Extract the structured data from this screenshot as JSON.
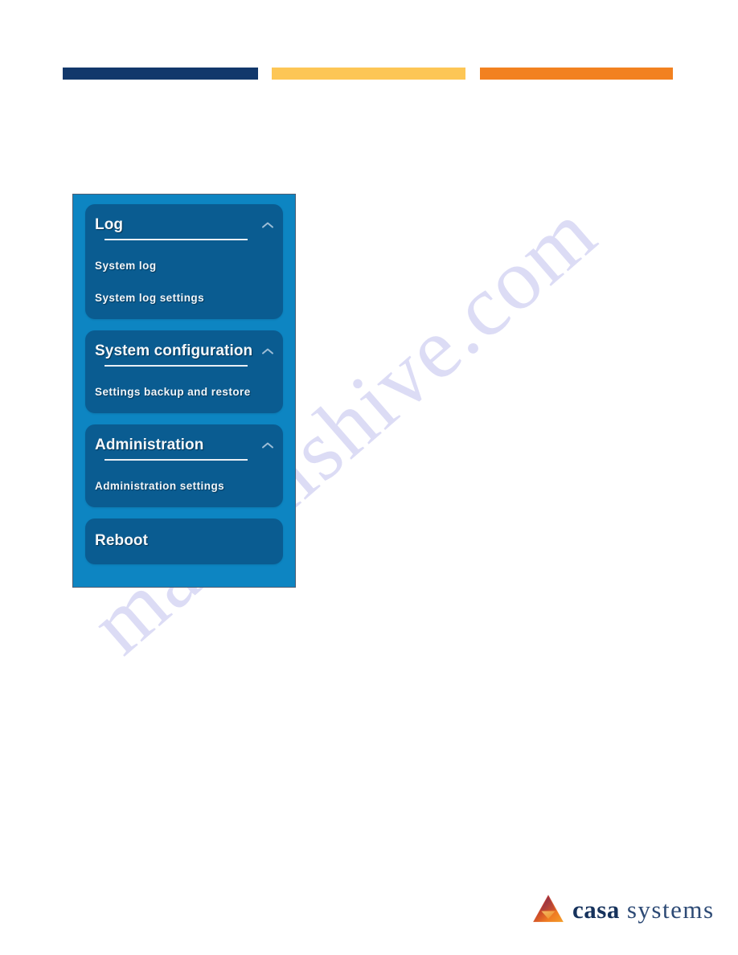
{
  "page": {
    "watermark_text": "manualshive.com",
    "background_color": "#ffffff"
  },
  "top_bars": [
    {
      "name": "navy-bar",
      "color": "#12386b"
    },
    {
      "name": "amber-bar",
      "color": "#fdc655"
    },
    {
      "name": "orange-bar",
      "color": "#f28120"
    }
  ],
  "menu_panel": {
    "panel_background": "#0d85c2",
    "card_background": "#0a5c91",
    "sections": [
      {
        "title": "Log",
        "expanded": true,
        "chevron_icon": "chevron-up-icon",
        "items": [
          {
            "label": "System log"
          },
          {
            "label": "System log settings"
          }
        ]
      },
      {
        "title": "System configuration",
        "expanded": true,
        "chevron_icon": "chevron-up-icon",
        "items": [
          {
            "label": "Settings backup and restore"
          }
        ]
      },
      {
        "title": "Administration",
        "expanded": true,
        "chevron_icon": "chevron-up-icon",
        "items": [
          {
            "label": "Administration settings"
          }
        ]
      },
      {
        "title": "Reboot",
        "expanded": false,
        "chevron_icon": "",
        "items": []
      }
    ]
  },
  "footer": {
    "logo_icon": "casa-systems-triangle-logo-icon",
    "brand_primary": "casa",
    "brand_secondary": "systems",
    "brand_primary_color": "#16325c",
    "brand_secondary_color": "#2d4a75"
  }
}
